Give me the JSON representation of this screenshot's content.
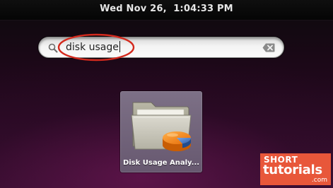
{
  "top_bar": {
    "clock": "Wed Nov 26,  1:04:33 PM"
  },
  "search": {
    "query": "disk usage",
    "search_icon": "magnifier-icon",
    "clear_icon": "clear-text-icon",
    "annotation_color": "#d42a1e"
  },
  "results": {
    "apps": [
      {
        "label": "Disk Usage Analy...",
        "icon": "folder-pie-chart-icon"
      }
    ]
  },
  "watermark": {
    "line1": "SHORT",
    "line2": "tutorials",
    "line3": ".com",
    "color": "#e8573a"
  },
  "colors": {
    "top_bar": "#0a0a0a",
    "background": "#2b0b26",
    "tile": "#7a6e86"
  }
}
